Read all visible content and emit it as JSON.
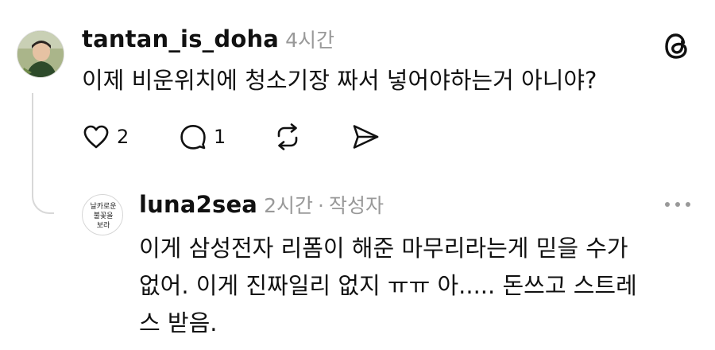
{
  "comment": {
    "username": "tantan_is_doha",
    "time": "4시간",
    "text": "이제 비운위치에 청소기장 짜서 넣어야하는거 아니야?",
    "likes": "2",
    "replies": "1"
  },
  "reply": {
    "username": "luna2sea",
    "time": "2시간",
    "author_tag": "작성자",
    "avatar_text": [
      "날카로운",
      "불꽃을",
      "보라"
    ],
    "lines": [
      "이게 삼성전자 리폼이 해준 마무리라는게 믿을 수가",
      "없어. 이게 진짜일리 없지 ㅠㅠ 아..... 돈쓰고 스트레",
      "스 받음."
    ]
  },
  "icons": {
    "brand": "threads-logo-icon",
    "like": "heart-icon",
    "comment": "comment-bubble-icon",
    "repost": "repost-icon",
    "share": "send-icon",
    "more": "more-dots-icon"
  }
}
